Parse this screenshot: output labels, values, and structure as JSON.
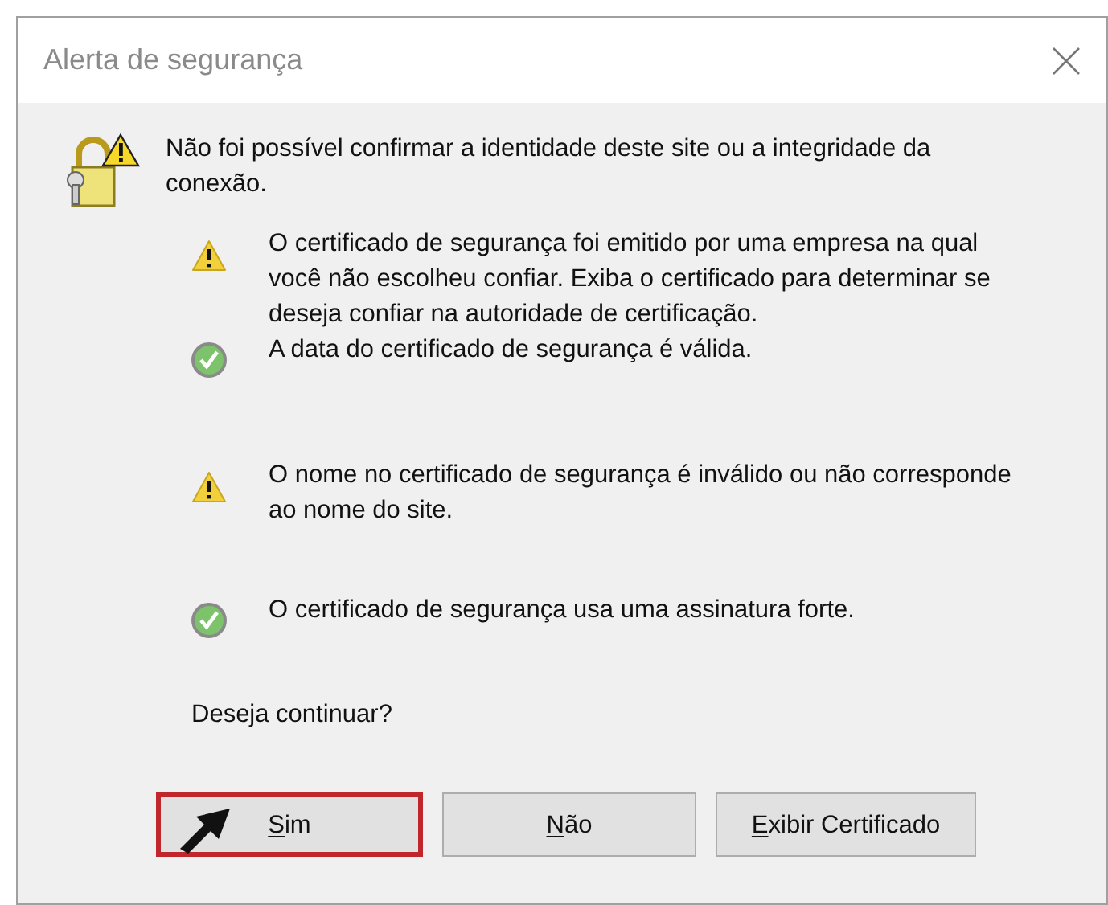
{
  "window": {
    "title": "Alerta de segurança"
  },
  "message": "Não foi possível confirmar a identidade deste site ou a integridade da conexão.",
  "checks": [
    {
      "kind": "warning",
      "text": "O certificado de segurança foi emitido por uma empresa na qual você não escolheu confiar. Exiba o certificado para determinar se deseja confiar na autoridade de certificação."
    },
    {
      "kind": "ok",
      "text": "A data do certificado de segurança é válida."
    },
    {
      "kind": "warning",
      "text": "O nome no certificado de segurança é inválido ou não corresponde ao nome do site."
    },
    {
      "kind": "ok",
      "text": "O certificado de segurança usa uma assinatura forte."
    }
  ],
  "question": "Deseja continuar?",
  "buttons": [
    {
      "label": "Sim",
      "highlighted": true
    },
    {
      "label": "Não",
      "highlighted": false
    },
    {
      "label": "Exibir Certificado",
      "highlighted": false
    }
  ]
}
